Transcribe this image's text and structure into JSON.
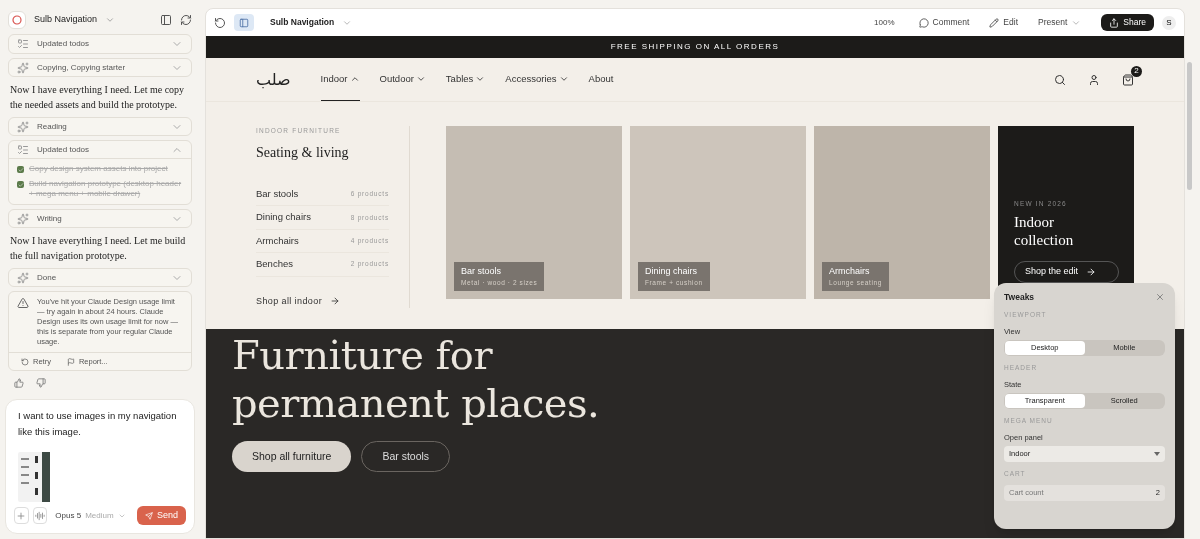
{
  "sidebar": {
    "title": "Sulb Navigation",
    "messages": [
      {
        "kind": "todos",
        "label": "Updated todos",
        "expanded": false
      },
      {
        "kind": "step",
        "label": "Copying, Copying starter",
        "expanded": false
      },
      {
        "kind": "text",
        "text": "Now I have everything I need. Let me copy the needed assets and build the prototype."
      },
      {
        "kind": "step",
        "label": "Reading",
        "expanded": false
      },
      {
        "kind": "todos",
        "label": "Updated todos",
        "expanded": true,
        "items": [
          {
            "text": "Copy design system assets into project",
            "checked": true
          },
          {
            "text": "Build navigation prototype (desktop header + mega menu + mobile drawer)",
            "checked": true
          }
        ]
      },
      {
        "kind": "step",
        "label": "Writing",
        "expanded": false
      },
      {
        "kind": "text",
        "text": "Now I have everything I need. Let me build the full navigation prototype."
      },
      {
        "kind": "step",
        "label": "Done",
        "expanded": false
      },
      {
        "kind": "warning",
        "text": "You've hit your Claude Design usage limit — try again in about 24 hours. Claude Design uses its own usage limit for now — this is separate from your regular Claude usage.",
        "actions": [
          "Retry",
          "Report..."
        ]
      }
    ],
    "composer": {
      "value": "I want to use images in my navigation like this image.",
      "model": "Opus 5",
      "effort": "Medium",
      "send": "Send"
    }
  },
  "toolbar": {
    "title": "Sulb Navigation",
    "zoom": "100%",
    "actions": [
      "Comment",
      "Edit",
      "Present"
    ],
    "share": "Share",
    "avatar": "S"
  },
  "site": {
    "banner": "FREE SHIPPING ON ALL ORDERS",
    "logo": "صلب",
    "nav": [
      {
        "label": "Indoor",
        "kind": "menu",
        "expanded": true
      },
      {
        "label": "Outdoor",
        "kind": "menu",
        "expanded": false
      },
      {
        "label": "Tables",
        "kind": "menu",
        "expanded": false
      },
      {
        "label": "Accessories",
        "kind": "menu",
        "expanded": false
      },
      {
        "label": "About",
        "kind": "link",
        "expanded": false
      }
    ],
    "cart_count": "2",
    "mega": {
      "eyebrow": "INDOOR FURNITURE",
      "heading": "Seating & living",
      "categories": [
        {
          "name": "Bar stools",
          "count": "6 products"
        },
        {
          "name": "Dining chairs",
          "count": "8 products"
        },
        {
          "name": "Armchairs",
          "count": "4 products"
        },
        {
          "name": "Benches",
          "count": "2 products"
        }
      ],
      "shop_all": "Shop all indoor",
      "cards": [
        {
          "title": "Bar stools",
          "subtitle": "Metal · wood · 2 sizes",
          "color": "#c5bdb3"
        },
        {
          "title": "Dining chairs",
          "subtitle": "Frame + cushion",
          "color": "#cdc5bb"
        },
        {
          "title": "Armchairs",
          "subtitle": "Lounge seating",
          "color": "#beb5aa"
        }
      ],
      "promo": {
        "eyebrow": "NEW IN 2026",
        "title": "Indoor collection",
        "button": "Shop the edit"
      }
    },
    "hero": {
      "lines": [
        "Furniture for",
        "permanent places."
      ],
      "buttons": [
        {
          "label": "Shop all furniture",
          "kind": "primary"
        },
        {
          "label": "Bar stools",
          "kind": "outline"
        }
      ]
    }
  },
  "tweaks": {
    "title": "Tweaks",
    "sections": [
      {
        "heading": "VIEWPORT",
        "label": "View",
        "kind": "segmented",
        "options": [
          {
            "label": "Desktop",
            "selected": true
          },
          {
            "label": "Mobile",
            "selected": false
          }
        ]
      },
      {
        "heading": "HEADER",
        "label": "State",
        "kind": "segmented",
        "options": [
          {
            "label": "Transparent",
            "selected": true
          },
          {
            "label": "Scrolled",
            "selected": false
          }
        ]
      },
      {
        "heading": "MEGA MENU",
        "label": "Open panel",
        "kind": "select",
        "value": "Indoor"
      },
      {
        "heading": "CART",
        "label": "Cart count",
        "kind": "number",
        "value": "2"
      }
    ]
  }
}
